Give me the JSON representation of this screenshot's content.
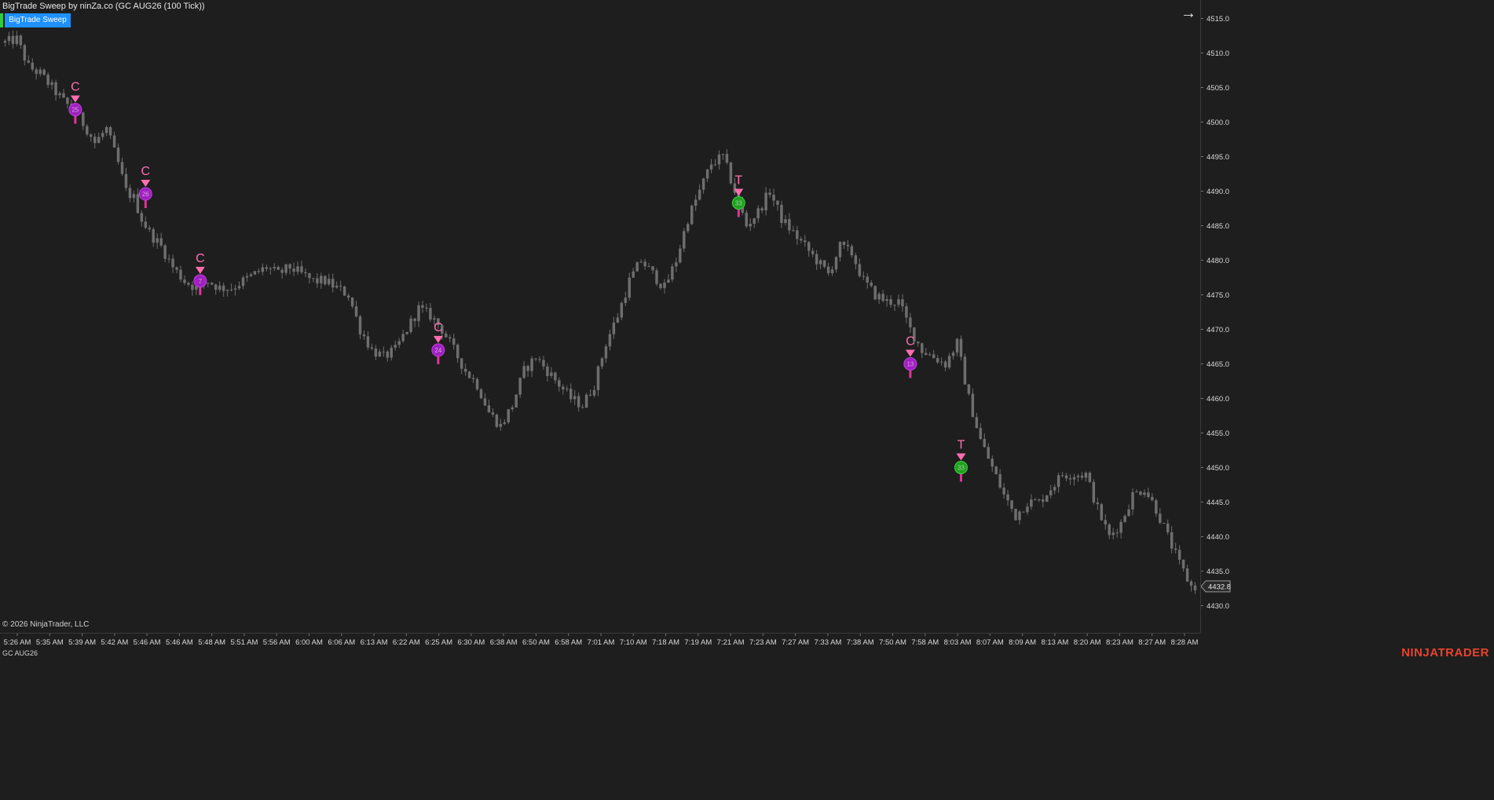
{
  "chart_title": "BigTrade Sweep by ninZa.co (GC AUG26 (100 Tick))",
  "indicator_button_label": "BigTrade Sweep",
  "arrow_icon": "arrow-right-icon",
  "copyright": "© 2026 NinjaTrader, LLC",
  "instrument_label": "GC AUG26",
  "brand": "NINJATRADER",
  "last_price_label": "4432.8",
  "colors": {
    "background": "#1e1e1e",
    "candles": "#6e6e6e",
    "signal_letter": "#ff6eb0",
    "bubble_purple": "#a020c0",
    "bubble_green": "#20a020",
    "indicator_button": "#1e90ff",
    "brand": "#e8432e"
  },
  "chart_data": {
    "type": "line",
    "title": "",
    "xlabel": "",
    "ylabel": "",
    "ylim": [
      4428.3,
      4517.4
    ],
    "price_ticks": [
      4515.0,
      4510.0,
      4505.0,
      4500.0,
      4495.0,
      4490.0,
      4485.0,
      4480.0,
      4475.0,
      4470.0,
      4465.0,
      4460.0,
      4455.0,
      4450.0,
      4445.0,
      4440.0,
      4435.0,
      4430.0
    ],
    "time_ticks": [
      "5:26 AM",
      "5:35 AM",
      "5:39 AM",
      "5:42 AM",
      "5:46 AM",
      "5:46 AM",
      "5:48 AM",
      "5:51 AM",
      "5:56 AM",
      "6:00 AM",
      "6:06 AM",
      "6:13 AM",
      "6:22 AM",
      "6:25 AM",
      "6:30 AM",
      "6:38 AM",
      "6:50 AM",
      "6:58 AM",
      "7:01 AM",
      "7:10 AM",
      "7:18 AM",
      "7:19 AM",
      "7:21 AM",
      "7:23 AM",
      "7:27 AM",
      "7:33 AM",
      "7:38 AM",
      "7:50 AM",
      "7:58 AM",
      "8:03 AM",
      "8:07 AM",
      "8:09 AM",
      "8:13 AM",
      "8:20 AM",
      "8:23 AM",
      "8:27 AM",
      "8:28 AM"
    ],
    "price_path": [
      [
        0,
        4511.5
      ],
      [
        3,
        4512
      ],
      [
        6,
        4508
      ],
      [
        9,
        4507
      ],
      [
        12,
        4505
      ],
      [
        15,
        4503
      ],
      [
        18,
        4501.5
      ],
      [
        21,
        4499
      ],
      [
        23,
        4497
      ],
      [
        26,
        4499
      ],
      [
        29,
        4494
      ],
      [
        31,
        4490
      ],
      [
        33,
        4489
      ],
      [
        35,
        4486
      ],
      [
        37,
        4484
      ],
      [
        40,
        4482
      ],
      [
        43,
        4479
      ],
      [
        46,
        4477
      ],
      [
        49,
        4476
      ],
      [
        52,
        4477
      ],
      [
        55,
        4476
      ],
      [
        58,
        4476
      ],
      [
        61,
        4477
      ],
      [
        64,
        4478
      ],
      [
        67,
        4479
      ],
      [
        70,
        4478
      ],
      [
        73,
        4479
      ],
      [
        76,
        4478
      ],
      [
        79,
        4477
      ],
      [
        82,
        4477
      ],
      [
        85,
        4476
      ],
      [
        88,
        4475
      ],
      [
        91,
        4470
      ],
      [
        94,
        4467
      ],
      [
        97,
        4466
      ],
      [
        100,
        4467
      ],
      [
        103,
        4470
      ],
      [
        106,
        4473
      ],
      [
        109,
        4472
      ],
      [
        112,
        4470
      ],
      [
        115,
        4467
      ],
      [
        118,
        4464
      ],
      [
        121,
        4462
      ],
      [
        124,
        4458
      ],
      [
        127,
        4456
      ],
      [
        130,
        4459
      ],
      [
        133,
        4464
      ],
      [
        136,
        4466
      ],
      [
        139,
        4464
      ],
      [
        142,
        4462
      ],
      [
        145,
        4460
      ],
      [
        148,
        4459
      ],
      [
        151,
        4462
      ],
      [
        154,
        4468
      ],
      [
        157,
        4472
      ],
      [
        160,
        4477
      ],
      [
        163,
        4480
      ],
      [
        166,
        4478
      ],
      [
        169,
        4476
      ],
      [
        172,
        4480
      ],
      [
        175,
        4486
      ],
      [
        178,
        4490
      ],
      [
        181,
        4494
      ],
      [
        184,
        4495
      ],
      [
        187,
        4490
      ],
      [
        190,
        4485
      ],
      [
        193,
        4487
      ],
      [
        196,
        4490
      ],
      [
        199,
        4486
      ],
      [
        202,
        4484
      ],
      [
        205,
        4482
      ],
      [
        208,
        4480
      ],
      [
        211,
        4478
      ],
      [
        214,
        4482
      ],
      [
        217,
        4481
      ],
      [
        220,
        4477
      ],
      [
        223,
        4475
      ],
      [
        226,
        4474
      ],
      [
        229,
        4474
      ],
      [
        232,
        4470
      ],
      [
        235,
        4467
      ],
      [
        238,
        4466
      ],
      [
        241,
        4465
      ],
      [
        244,
        4468
      ],
      [
        247,
        4460
      ],
      [
        250,
        4454
      ],
      [
        253,
        4450
      ],
      [
        256,
        4446
      ],
      [
        259,
        4443
      ],
      [
        262,
        4445
      ],
      [
        265,
        4445
      ],
      [
        268,
        4447
      ],
      [
        271,
        4449
      ],
      [
        274,
        4449
      ],
      [
        277,
        4449
      ],
      [
        280,
        4444
      ],
      [
        283,
        4440
      ],
      [
        286,
        4442
      ],
      [
        289,
        4446
      ],
      [
        292,
        4447
      ],
      [
        295,
        4444
      ],
      [
        298,
        4440
      ],
      [
        301,
        4436
      ],
      [
        304,
        4432.8
      ]
    ],
    "signals": [
      {
        "letter": "C",
        "direction": "down",
        "bubble": "purple",
        "bubble_label": "25",
        "bar": 18,
        "price": 4501.8
      },
      {
        "letter": "C",
        "direction": "down",
        "bubble": "purple",
        "bubble_label": "26",
        "bar": 36,
        "price": 4489.6
      },
      {
        "letter": "C",
        "direction": "down",
        "bubble": "purple",
        "bubble_label": "7",
        "bar": 50,
        "price": 4477.0
      },
      {
        "letter": "C",
        "direction": "down",
        "bubble": "purple",
        "bubble_label": "24",
        "bar": 111,
        "price": 4467.0
      },
      {
        "letter": "T",
        "direction": "down",
        "bubble": "green",
        "bubble_label": "33",
        "bar": 188,
        "price": 4488.3
      },
      {
        "letter": "C",
        "direction": "down",
        "bubble": "purple",
        "bubble_label": "13",
        "bar": 232,
        "price": 4465.0
      },
      {
        "letter": "T",
        "direction": "down",
        "bubble": "green",
        "bubble_label": "33",
        "bar": 245,
        "price": 4450.0
      }
    ]
  }
}
